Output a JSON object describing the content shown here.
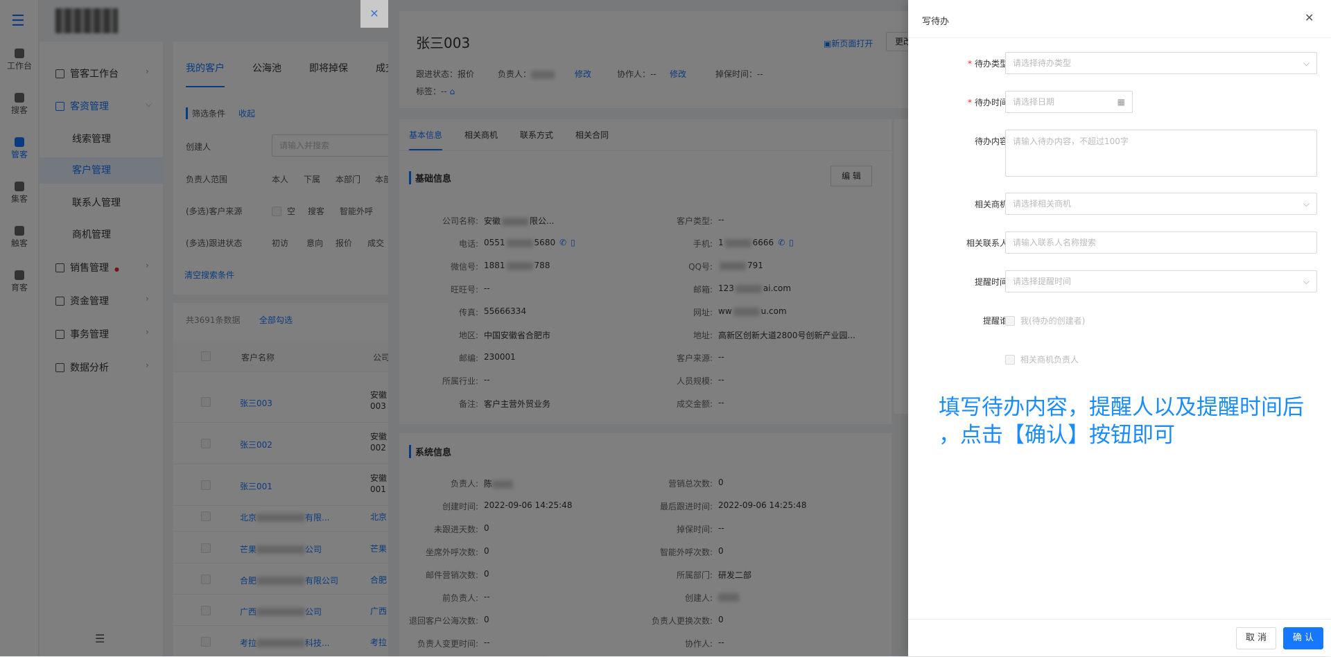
{
  "rail": {
    "items": [
      "工作台",
      "搜客",
      "管客",
      "集客",
      "触客",
      "育客"
    ]
  },
  "sidebar": {
    "items": [
      {
        "label": "管客工作台",
        "type": "nav"
      },
      {
        "label": "客资管理",
        "type": "nav",
        "active": true
      },
      {
        "label": "线索管理",
        "type": "sub"
      },
      {
        "label": "客户管理",
        "type": "sub",
        "selected": true
      },
      {
        "label": "联系人管理",
        "type": "sub"
      },
      {
        "label": "商机管理",
        "type": "sub"
      },
      {
        "label": "销售管理",
        "type": "nav"
      },
      {
        "label": "资金管理",
        "type": "nav"
      },
      {
        "label": "事务管理",
        "type": "nav"
      },
      {
        "label": "数据分析",
        "type": "nav"
      }
    ]
  },
  "list": {
    "tabs": [
      "我的客户",
      "公海池",
      "即将掉保",
      "成交"
    ],
    "filter_title": "筛选条件",
    "filter_collapse": "收起",
    "creator_label": "创建人",
    "creator_placeholder": "请输入并搜索",
    "owner_range_label": "负责人范围",
    "owner_range_options": [
      "本人",
      "下属",
      "本部门",
      "本部"
    ],
    "source_label": "(多选)客户来源",
    "source_options": [
      "空",
      "搜客",
      "智能外呼"
    ],
    "status_label": "(多选)跟进状态",
    "status_options": [
      "初访",
      "意向",
      "报价",
      "成交"
    ],
    "clear": "清空搜索条件",
    "total": "共3691条数据",
    "select_all": "全部勾选",
    "col_name": "客户名称",
    "col_company": "公司",
    "rows": [
      {
        "name": "张三003",
        "company": "安徽",
        "code": "003"
      },
      {
        "name": "张三002",
        "company": "安徽",
        "code": "002"
      },
      {
        "name": "张三001",
        "company": "安徽",
        "code": "001"
      },
      {
        "name": "北京",
        "name_tail": "有限...",
        "company": "北京"
      },
      {
        "name": "芒果",
        "name_tail": "公司",
        "company": "芒果"
      },
      {
        "name": "合肥",
        "name_tail": "有限公司",
        "company": "合肥"
      },
      {
        "name": "广西",
        "name_tail": "公司",
        "company": "广西"
      },
      {
        "name": "考拉",
        "name_tail": "科技...",
        "company": "考拉"
      }
    ]
  },
  "detail": {
    "title": "张三003",
    "open_new": "新页面打开",
    "change_btn": "更改",
    "follow_status": "跟进状态：报价",
    "owner_label": "负责人：",
    "edit1": "修改",
    "collab": "协作人：--",
    "edit2": "修改",
    "drop_time": "掉保时间：--",
    "tags": "标签：--",
    "tabs": [
      "基本信息",
      "相关商机",
      "联系方式",
      "相关合同"
    ],
    "basic_title": "基础信息",
    "edit_btn": "编 辑",
    "basic_left": [
      {
        "k": "公司名称:",
        "v": "安徽",
        "tail": "限公..."
      },
      {
        "k": "电话:",
        "v": "0551",
        "tail": "5680"
      },
      {
        "k": "微信号:",
        "v": "1881",
        "tail": "788"
      },
      {
        "k": "旺旺号:",
        "v": "--"
      },
      {
        "k": "传真:",
        "v": "55666334"
      },
      {
        "k": "地区:",
        "v": "中国安徽省合肥市"
      },
      {
        "k": "邮编:",
        "v": "230001"
      },
      {
        "k": "所属行业:",
        "v": "--"
      },
      {
        "k": "备注:",
        "v": "客户主营外贸业务"
      }
    ],
    "basic_right": [
      {
        "k": "客户类型:",
        "v": "--"
      },
      {
        "k": "手机:",
        "v": "1",
        "tail": "6666"
      },
      {
        "k": "QQ号:",
        "v": "",
        "tail": "791"
      },
      {
        "k": "邮箱:",
        "v": "123",
        "tail": "ai.com"
      },
      {
        "k": "网址:",
        "v": "ww",
        "tail": "u.com"
      },
      {
        "k": "地址:",
        "v": "高新区创新大道2800号创新产业园..."
      },
      {
        "k": "客户来源:",
        "v": "--"
      },
      {
        "k": "人员规模:",
        "v": "--"
      },
      {
        "k": "成交金额:",
        "v": "--"
      }
    ],
    "sys_title": "系统信息",
    "sys_left": [
      {
        "k": "负责人:",
        "v": "陈"
      },
      {
        "k": "创建时间:",
        "v": "2022-09-06 14:25:48"
      },
      {
        "k": "未跟进天数:",
        "v": "0"
      },
      {
        "k": "坐席外呼次数:",
        "v": "0"
      },
      {
        "k": "邮件营销次数:",
        "v": "0"
      },
      {
        "k": "前负责人:",
        "v": "--"
      },
      {
        "k": "退回客户公海次数:",
        "v": "0"
      },
      {
        "k": "负责人变更时间:",
        "v": "--"
      }
    ],
    "sys_right": [
      {
        "k": "营销总次数:",
        "v": "0"
      },
      {
        "k": "最后跟进时间:",
        "v": "2022-09-06 14:25:48"
      },
      {
        "k": "掉保时间:",
        "v": "--"
      },
      {
        "k": "智能外呼次数:",
        "v": "0"
      },
      {
        "k": "所属部门:",
        "v": "研发二部"
      },
      {
        "k": "创建人:",
        "v": ""
      },
      {
        "k": "负责人更换次数:",
        "v": "0"
      },
      {
        "k": "协作人:",
        "v": "--"
      }
    ]
  },
  "drawer": {
    "title": "写待办",
    "type_label": "待办类型:",
    "type_placeholder": "请选择待办类型",
    "time_label": "待办时间:",
    "time_placeholder": "请选择日期",
    "content_label": "待办内容:",
    "content_placeholder": "请输入待办内容，不超过100字",
    "opp_label": "相关商机:",
    "opp_placeholder": "请选择相关商机",
    "contact_label": "相关联系人:",
    "contact_placeholder": "请输入联系人名称搜索",
    "remind_time_label": "提醒时间:",
    "remind_time_placeholder": "请选择提醒时间",
    "remind_who_label": "提醒谁:",
    "remind_me": "我(待办的创建者)",
    "remind_opp_owner": "相关商机负责人",
    "annotation_line1": "填写待办内容，提醒人以及提醒时间后",
    "annotation_line2": "，点击【确认】按钮即可",
    "cancel": "取 消",
    "confirm": "确 认"
  },
  "colors": {
    "accent": "#1677ff",
    "annotation": "#1a8cff",
    "required": "#f5222d"
  }
}
